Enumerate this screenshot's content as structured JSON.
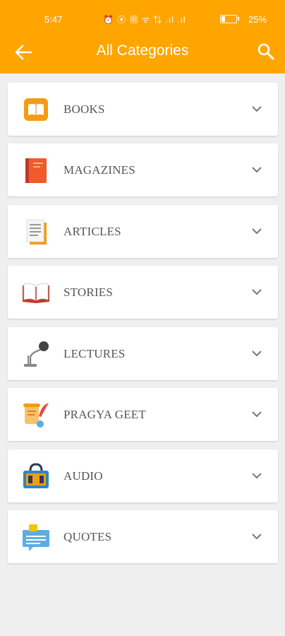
{
  "status_bar": {
    "time": "5:47",
    "icons": "⏰ ⦿ ▦ ᯤ ⇅ .ıl .ıl",
    "battery_percent": "25%"
  },
  "toolbar": {
    "title": "All Categories",
    "back_icon": "arrow-left-icon",
    "search_icon": "search-icon",
    "background_color": "#ffa500"
  },
  "categories": [
    {
      "label": "BOOKS",
      "icon": "book-icon"
    },
    {
      "label": "MAGAZINES",
      "icon": "magazine-icon"
    },
    {
      "label": "ARTICLES",
      "icon": "article-icon"
    },
    {
      "label": "STORIES",
      "icon": "open-book-icon"
    },
    {
      "label": "LECTURES",
      "icon": "microphone-icon"
    },
    {
      "label": "PRAGYA GEET",
      "icon": "scroll-quill-icon"
    },
    {
      "label": "AUDIO",
      "icon": "audio-bag-icon"
    },
    {
      "label": "QUOTES",
      "icon": "quote-bubble-icon"
    }
  ]
}
